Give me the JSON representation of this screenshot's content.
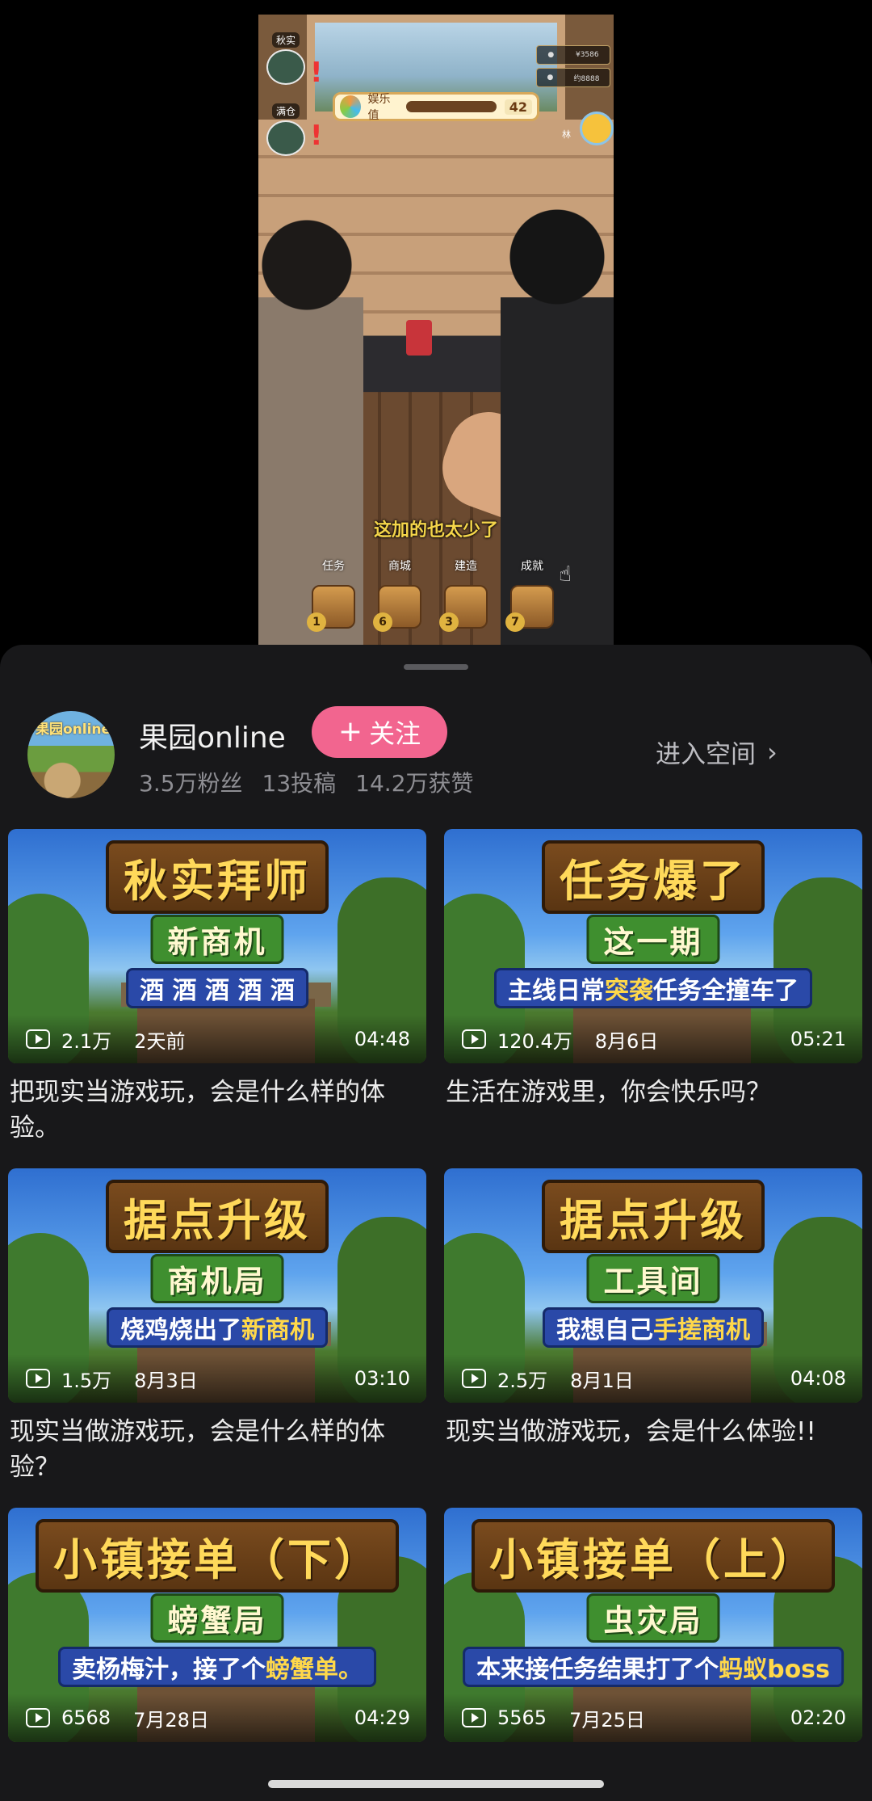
{
  "video": {
    "players": [
      {
        "name": "秋实"
      },
      {
        "name": "满仓"
      }
    ],
    "meter": {
      "label": "娱乐值",
      "value": "42",
      "fill_fraction": 0.78
    },
    "coins": [
      "¥3586",
      "约8888"
    ],
    "side_tag": "林",
    "subtitle": "这加的也太少了",
    "menu": [
      {
        "label": "任务",
        "count": "1"
      },
      {
        "label": "商城",
        "count": "6"
      },
      {
        "label": "建造",
        "count": "3"
      },
      {
        "label": "成就",
        "count": "7"
      }
    ]
  },
  "author": {
    "avatar_text": "果园online",
    "name": "果园online",
    "follow_label": "关注",
    "stats": {
      "fans": "3.5万粉丝",
      "posts": "13投稿",
      "likes": "14.2万获赞"
    },
    "space_link": "进入空间"
  },
  "videos": [
    {
      "thumb_title": "秋实拜师",
      "thumb_sub": "新商机",
      "thumb_line": [
        {
          "t": "酒 酒 酒 酒 酒",
          "hl": false
        }
      ],
      "views": "2.1万",
      "date": "2天前",
      "duration": "04:48",
      "title": "把现实当游戏玩，会是什么样的体验。"
    },
    {
      "thumb_title": "任务爆了",
      "thumb_sub": "这一期",
      "thumb_line": [
        {
          "t": "主线日常",
          "hl": false
        },
        {
          "t": "突袭",
          "hl": true
        },
        {
          "t": "任务全撞车了",
          "hl": false
        }
      ],
      "views": "120.4万",
      "date": "8月6日",
      "duration": "05:21",
      "title": "生活在游戏里，你会快乐吗？"
    },
    {
      "thumb_title": "据点升级",
      "thumb_sub": "商机局",
      "thumb_line": [
        {
          "t": "烧鸡烧出了",
          "hl": false
        },
        {
          "t": "新商机",
          "hl": true
        }
      ],
      "views": "1.5万",
      "date": "8月3日",
      "duration": "03:10",
      "title": "现实当做游戏玩，会是什么样的体验？"
    },
    {
      "thumb_title": "据点升级",
      "thumb_sub": "工具间",
      "thumb_line": [
        {
          "t": "我想自己",
          "hl": false
        },
        {
          "t": "手搓商机",
          "hl": true
        }
      ],
      "views": "2.5万",
      "date": "8月1日",
      "duration": "04:08",
      "title": "现实当做游戏玩，会是什么体验!!"
    },
    {
      "thumb_title": "小镇接单（下）",
      "thumb_sub": "螃蟹局",
      "thumb_line": [
        {
          "t": "卖杨梅汁，接了个",
          "hl": false
        },
        {
          "t": "螃蟹单。",
          "hl": true
        }
      ],
      "views": "6568",
      "date": "7月28日",
      "duration": "04:29",
      "title": ""
    },
    {
      "thumb_title": "小镇接单（上）",
      "thumb_sub": "虫灾局",
      "thumb_line": [
        {
          "t": "本来接任务结果打了个",
          "hl": false
        },
        {
          "t": "蚂蚁boss",
          "hl": true
        }
      ],
      "views": "5565",
      "date": "7月25日",
      "duration": "02:20",
      "title": ""
    }
  ]
}
